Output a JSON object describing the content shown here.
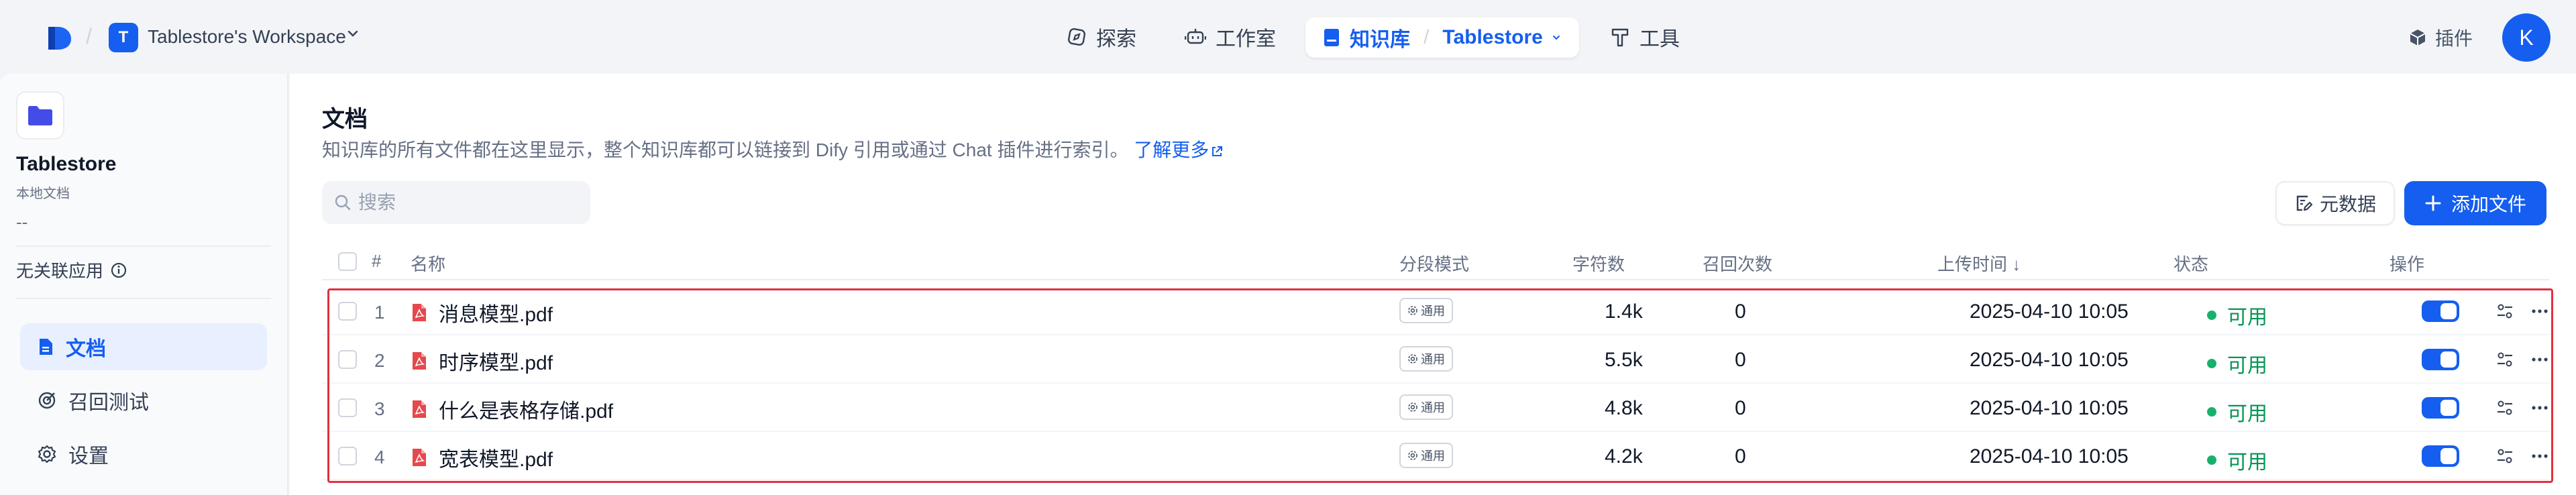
{
  "header": {
    "workspace_initial": "T",
    "workspace_name": "Tablestore's Workspace",
    "nav": {
      "explore": "探索",
      "studio": "工作室",
      "knowledge": "知识库",
      "dataset": "Tablestore",
      "tools": "工具"
    },
    "plugins": "插件",
    "user_initial": "K"
  },
  "sidebar": {
    "title": "Tablestore",
    "subtitle": "本地文档",
    "description": "--",
    "unlinked": "无关联应用",
    "nav": [
      {
        "label": "文档",
        "active": true
      },
      {
        "label": "召回测试",
        "active": false
      },
      {
        "label": "设置",
        "active": false
      }
    ]
  },
  "main": {
    "title": "文档",
    "description": "知识库的所有文件都在这里显示，整个知识库都可以链接到 Dify 引用或通过 Chat 插件进行索引。",
    "learn_more": "了解更多",
    "search_placeholder": "搜索",
    "meta_button": "元数据",
    "add_button": "添加文件",
    "columns": {
      "index": "#",
      "name": "名称",
      "mode": "分段模式",
      "chars": "字符数",
      "hits": "召回次数",
      "uploaded": "上传时间 ↓",
      "status": "状态",
      "actions": "操作"
    },
    "rows": [
      {
        "index": "1",
        "name": "消息模型.pdf",
        "mode": "通用",
        "chars": "1.4k",
        "hits": "0",
        "uploaded": "2025-04-10 10:05",
        "status": "可用",
        "enabled": true
      },
      {
        "index": "2",
        "name": "时序模型.pdf",
        "mode": "通用",
        "chars": "5.5k",
        "hits": "0",
        "uploaded": "2025-04-10 10:05",
        "status": "可用",
        "enabled": true
      },
      {
        "index": "3",
        "name": "什么是表格存储.pdf",
        "mode": "通用",
        "chars": "4.8k",
        "hits": "0",
        "uploaded": "2025-04-10 10:05",
        "status": "可用",
        "enabled": true
      },
      {
        "index": "4",
        "name": "宽表模型.pdf",
        "mode": "通用",
        "chars": "4.2k",
        "hits": "0",
        "uploaded": "2025-04-10 10:05",
        "status": "可用",
        "enabled": true
      }
    ]
  },
  "colors": {
    "accent": "#155eef",
    "status_green": "#17b26a",
    "pdf_red": "#e5484d",
    "highlight_border": "#e03040"
  }
}
